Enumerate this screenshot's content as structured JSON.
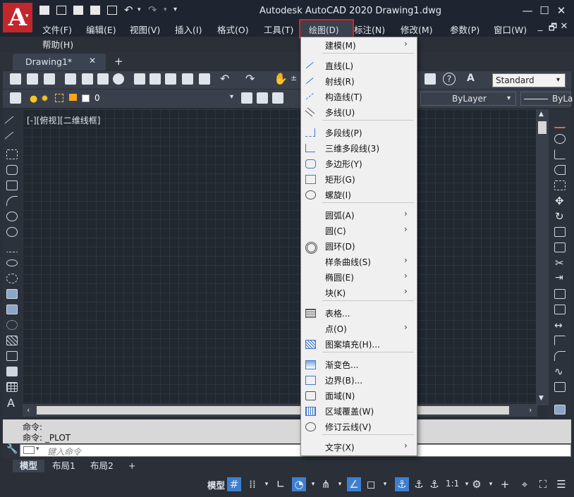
{
  "window": {
    "title": "Autodesk AutoCAD 2020    Drawing1.dwg",
    "logo_letter": "A",
    "minimize": "—",
    "maximize": "☐",
    "close": "✕",
    "doc_minimize": "_",
    "doc_restore": "🗗",
    "doc_close": "✕"
  },
  "menubar": {
    "file": "文件(F)",
    "edit": "编辑(E)",
    "view": "视图(V)",
    "insert": "插入(I)",
    "format": "格式(O)",
    "tools": "工具(T)",
    "draw": "绘图(D)",
    "dimension": "标注(N)",
    "modify": "修改(M)",
    "parameters": "参数(P)",
    "window": "窗口(W)",
    "help": "帮助(H)"
  },
  "tabs": {
    "document": "Drawing1*",
    "close": "✕",
    "add": "+"
  },
  "toolbar": {
    "text_style": "Standard",
    "layer": "0",
    "color": "ByLayer",
    "linetype": "ByLa"
  },
  "viewport": {
    "label": "[-][俯视][二维线框]"
  },
  "draw_menu": {
    "items": [
      {
        "label": "建模(M)",
        "submenu": true,
        "icon": "none"
      },
      {
        "label": "直线(L)",
        "submenu": false,
        "icon": "line-icon"
      },
      {
        "label": "射线(R)",
        "submenu": false,
        "icon": "ray-icon"
      },
      {
        "label": "构造线(T)",
        "submenu": false,
        "icon": "xline-icon"
      },
      {
        "label": "多线(U)",
        "submenu": false,
        "icon": "mline-icon"
      },
      {
        "label": "多段线(P)",
        "submenu": false,
        "icon": "polyline-icon"
      },
      {
        "label": "三维多段线(3)",
        "submenu": false,
        "icon": "3dpolyline-icon"
      },
      {
        "label": "多边形(Y)",
        "submenu": false,
        "icon": "polygon-icon"
      },
      {
        "label": "矩形(G)",
        "submenu": false,
        "icon": "rectangle-icon"
      },
      {
        "label": "螺旋(I)",
        "submenu": false,
        "icon": "helix-icon"
      },
      {
        "label": "圆弧(A)",
        "submenu": true,
        "icon": "none"
      },
      {
        "label": "圆(C)",
        "submenu": true,
        "icon": "none"
      },
      {
        "label": "圆环(D)",
        "submenu": false,
        "icon": "donut-icon"
      },
      {
        "label": "样条曲线(S)",
        "submenu": true,
        "icon": "none"
      },
      {
        "label": "椭圆(E)",
        "submenu": true,
        "icon": "none"
      },
      {
        "label": "块(K)",
        "submenu": true,
        "icon": "none"
      },
      {
        "label": "表格...",
        "submenu": false,
        "icon": "table-icon"
      },
      {
        "label": "点(O)",
        "submenu": true,
        "icon": "none"
      },
      {
        "label": "图案填充(H)...",
        "submenu": false,
        "icon": "hatch-icon"
      },
      {
        "label": "渐变色...",
        "submenu": false,
        "icon": "gradient-icon"
      },
      {
        "label": "边界(B)...",
        "submenu": false,
        "icon": "boundary-icon"
      },
      {
        "label": "面域(N)",
        "submenu": false,
        "icon": "region-icon"
      },
      {
        "label": "区域覆盖(W)",
        "submenu": false,
        "icon": "wipeout-icon"
      },
      {
        "label": "修订云线(V)",
        "submenu": false,
        "icon": "revcloud-icon"
      },
      {
        "label": "文字(X)",
        "submenu": true,
        "icon": "none"
      }
    ],
    "arrow": "›"
  },
  "command": {
    "line1": "命令:",
    "line2": "命令:  _PLOT",
    "placeholder": "键入命令"
  },
  "layout_tabs": {
    "model": "模型",
    "layout1": "布局1",
    "layout2": "布局2",
    "add": "+"
  },
  "statusbar": {
    "model": "模型",
    "scale": "1:1"
  },
  "accent_color": "#e0201c"
}
